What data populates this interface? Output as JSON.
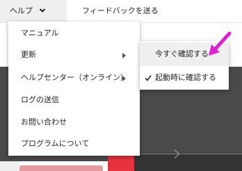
{
  "menubar": {
    "help_label": "ヘルプ",
    "feedback_label": "フィードバックを送る"
  },
  "help_menu": {
    "items": [
      {
        "label": "マニュアル",
        "has_submenu": false
      },
      {
        "label": "更新",
        "has_submenu": true
      },
      {
        "label": "ヘルプセンター（オンライン）",
        "has_submenu": true
      },
      {
        "label": "ログの送信",
        "has_submenu": false
      },
      {
        "label": "お問い合わせ",
        "has_submenu": false
      },
      {
        "label": "プログラムについて",
        "has_submenu": false
      }
    ]
  },
  "update_submenu": {
    "items": [
      {
        "label": "今すぐ確認する",
        "highlighted": true,
        "checked": false
      },
      {
        "label": "起動時に確認する",
        "highlighted": false,
        "checked": true
      }
    ]
  },
  "colors": {
    "annotation_arrow": "#e020d0",
    "menu_highlight": "#efefef",
    "background_dark": "#4a4a4a",
    "accent_red": "#e8323f"
  }
}
